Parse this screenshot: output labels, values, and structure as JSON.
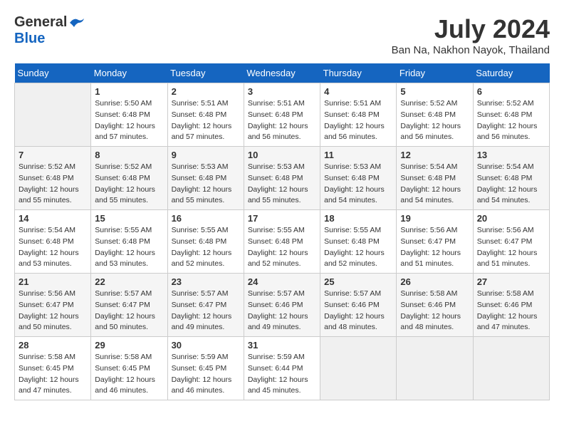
{
  "logo": {
    "general": "General",
    "blue": "Blue"
  },
  "title": {
    "month_year": "July 2024",
    "location": "Ban Na, Nakhon Nayok, Thailand"
  },
  "weekdays": [
    "Sunday",
    "Monday",
    "Tuesday",
    "Wednesday",
    "Thursday",
    "Friday",
    "Saturday"
  ],
  "weeks": [
    [
      {
        "day": "",
        "info": ""
      },
      {
        "day": "1",
        "info": "Sunrise: 5:50 AM\nSunset: 6:48 PM\nDaylight: 12 hours\nand 57 minutes."
      },
      {
        "day": "2",
        "info": "Sunrise: 5:51 AM\nSunset: 6:48 PM\nDaylight: 12 hours\nand 57 minutes."
      },
      {
        "day": "3",
        "info": "Sunrise: 5:51 AM\nSunset: 6:48 PM\nDaylight: 12 hours\nand 56 minutes."
      },
      {
        "day": "4",
        "info": "Sunrise: 5:51 AM\nSunset: 6:48 PM\nDaylight: 12 hours\nand 56 minutes."
      },
      {
        "day": "5",
        "info": "Sunrise: 5:52 AM\nSunset: 6:48 PM\nDaylight: 12 hours\nand 56 minutes."
      },
      {
        "day": "6",
        "info": "Sunrise: 5:52 AM\nSunset: 6:48 PM\nDaylight: 12 hours\nand 56 minutes."
      }
    ],
    [
      {
        "day": "7",
        "info": "Sunrise: 5:52 AM\nSunset: 6:48 PM\nDaylight: 12 hours\nand 55 minutes."
      },
      {
        "day": "8",
        "info": "Sunrise: 5:52 AM\nSunset: 6:48 PM\nDaylight: 12 hours\nand 55 minutes."
      },
      {
        "day": "9",
        "info": "Sunrise: 5:53 AM\nSunset: 6:48 PM\nDaylight: 12 hours\nand 55 minutes."
      },
      {
        "day": "10",
        "info": "Sunrise: 5:53 AM\nSunset: 6:48 PM\nDaylight: 12 hours\nand 55 minutes."
      },
      {
        "day": "11",
        "info": "Sunrise: 5:53 AM\nSunset: 6:48 PM\nDaylight: 12 hours\nand 54 minutes."
      },
      {
        "day": "12",
        "info": "Sunrise: 5:54 AM\nSunset: 6:48 PM\nDaylight: 12 hours\nand 54 minutes."
      },
      {
        "day": "13",
        "info": "Sunrise: 5:54 AM\nSunset: 6:48 PM\nDaylight: 12 hours\nand 54 minutes."
      }
    ],
    [
      {
        "day": "14",
        "info": "Sunrise: 5:54 AM\nSunset: 6:48 PM\nDaylight: 12 hours\nand 53 minutes."
      },
      {
        "day": "15",
        "info": "Sunrise: 5:55 AM\nSunset: 6:48 PM\nDaylight: 12 hours\nand 53 minutes."
      },
      {
        "day": "16",
        "info": "Sunrise: 5:55 AM\nSunset: 6:48 PM\nDaylight: 12 hours\nand 52 minutes."
      },
      {
        "day": "17",
        "info": "Sunrise: 5:55 AM\nSunset: 6:48 PM\nDaylight: 12 hours\nand 52 minutes."
      },
      {
        "day": "18",
        "info": "Sunrise: 5:55 AM\nSunset: 6:48 PM\nDaylight: 12 hours\nand 52 minutes."
      },
      {
        "day": "19",
        "info": "Sunrise: 5:56 AM\nSunset: 6:47 PM\nDaylight: 12 hours\nand 51 minutes."
      },
      {
        "day": "20",
        "info": "Sunrise: 5:56 AM\nSunset: 6:47 PM\nDaylight: 12 hours\nand 51 minutes."
      }
    ],
    [
      {
        "day": "21",
        "info": "Sunrise: 5:56 AM\nSunset: 6:47 PM\nDaylight: 12 hours\nand 50 minutes."
      },
      {
        "day": "22",
        "info": "Sunrise: 5:57 AM\nSunset: 6:47 PM\nDaylight: 12 hours\nand 50 minutes."
      },
      {
        "day": "23",
        "info": "Sunrise: 5:57 AM\nSunset: 6:47 PM\nDaylight: 12 hours\nand 49 minutes."
      },
      {
        "day": "24",
        "info": "Sunrise: 5:57 AM\nSunset: 6:46 PM\nDaylight: 12 hours\nand 49 minutes."
      },
      {
        "day": "25",
        "info": "Sunrise: 5:57 AM\nSunset: 6:46 PM\nDaylight: 12 hours\nand 48 minutes."
      },
      {
        "day": "26",
        "info": "Sunrise: 5:58 AM\nSunset: 6:46 PM\nDaylight: 12 hours\nand 48 minutes."
      },
      {
        "day": "27",
        "info": "Sunrise: 5:58 AM\nSunset: 6:46 PM\nDaylight: 12 hours\nand 47 minutes."
      }
    ],
    [
      {
        "day": "28",
        "info": "Sunrise: 5:58 AM\nSunset: 6:45 PM\nDaylight: 12 hours\nand 47 minutes."
      },
      {
        "day": "29",
        "info": "Sunrise: 5:58 AM\nSunset: 6:45 PM\nDaylight: 12 hours\nand 46 minutes."
      },
      {
        "day": "30",
        "info": "Sunrise: 5:59 AM\nSunset: 6:45 PM\nDaylight: 12 hours\nand 46 minutes."
      },
      {
        "day": "31",
        "info": "Sunrise: 5:59 AM\nSunset: 6:44 PM\nDaylight: 12 hours\nand 45 minutes."
      },
      {
        "day": "",
        "info": ""
      },
      {
        "day": "",
        "info": ""
      },
      {
        "day": "",
        "info": ""
      }
    ]
  ]
}
